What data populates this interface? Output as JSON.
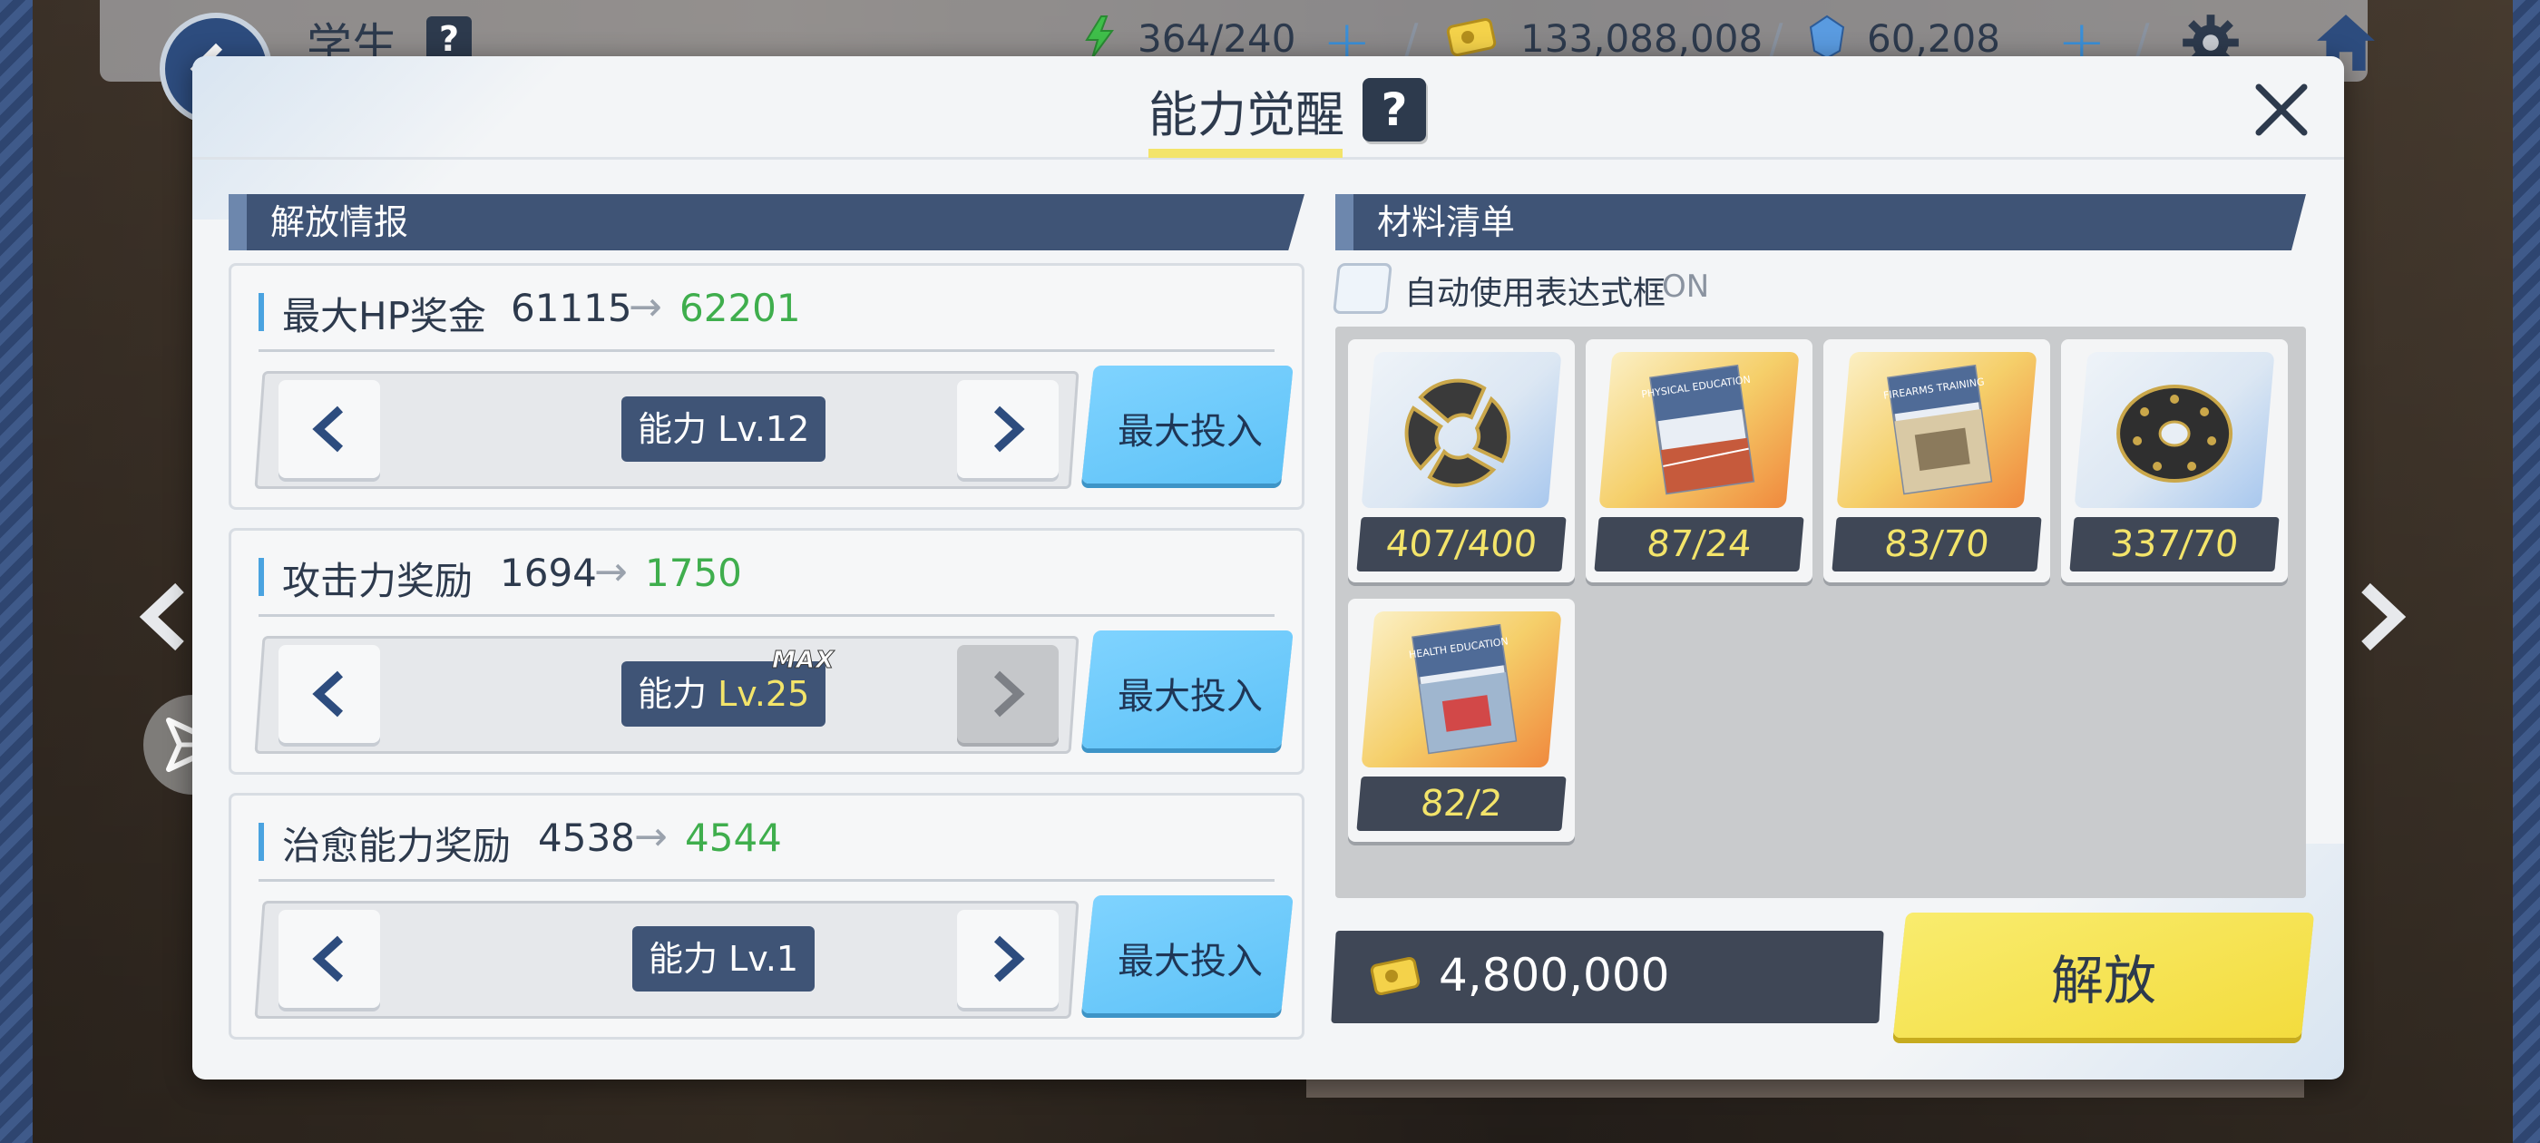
{
  "topbar": {
    "title": "学生",
    "help": "?",
    "ap": "364/240",
    "credits": "133,088,008",
    "gems": "60,208"
  },
  "modal": {
    "title": "能力觉醒",
    "help": "?"
  },
  "unlock_info": {
    "header": "解放情报",
    "stats": [
      {
        "label": "最大HP奖金",
        "old": "61115",
        "new": "62201",
        "level_prefix": "能力",
        "level": "Lv.12",
        "max": "",
        "max_input": "最大投入"
      },
      {
        "label": "攻击力奖励",
        "old": "1694",
        "new": "1750",
        "level_prefix": "能力",
        "level": "Lv.25",
        "max": "MAX",
        "max_input": "最大投入"
      },
      {
        "label": "治愈能力奖励",
        "old": "4538",
        "new": "4544",
        "level_prefix": "能力",
        "level": "Lv.1",
        "max": "",
        "max_input": "最大投入"
      }
    ]
  },
  "materials": {
    "header": "材料清单",
    "auto_label": "自动使用表达式框",
    "auto_state": "ON",
    "items": [
      {
        "icon": "broken-disc-icon",
        "count": "407/400",
        "tone": "blue"
      },
      {
        "icon": "physical-education-book-icon",
        "count": "87/24",
        "tone": "gold",
        "book_title": "PHYSICAL EDUCATION"
      },
      {
        "icon": "firearms-training-book-icon",
        "count": "83/70",
        "tone": "gold",
        "book_title": "FIREARMS TRAINING"
      },
      {
        "icon": "disc-icon",
        "count": "337/70",
        "tone": "blue"
      },
      {
        "icon": "health-education-book-icon",
        "count": "82/2",
        "tone": "gold",
        "book_title": "HEALTH EDUCATION"
      }
    ]
  },
  "cost": {
    "value": "4,800,000"
  },
  "unlock_button": "解放",
  "colors": {
    "accent_navy": "#3f5476",
    "highlight_yellow": "#f3e46a",
    "increase_green": "#3fae4d",
    "button_blue": "#5ec2f7"
  }
}
